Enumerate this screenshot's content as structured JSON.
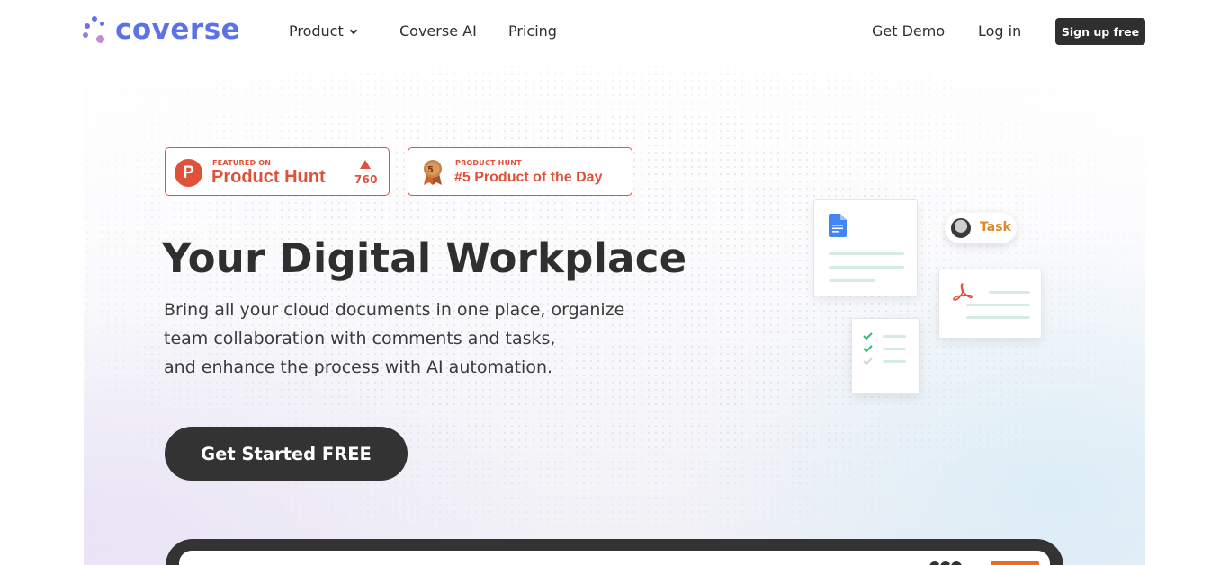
{
  "brand": {
    "name": "coverse",
    "colors": {
      "primary": "#5b72e8",
      "accent_orange": "#e0872d",
      "ph_red": "#e0513a",
      "dark": "#2f2f2f"
    }
  },
  "nav": {
    "links": [
      {
        "label": "Product",
        "has_dropdown": true
      },
      {
        "label": "Coverse AI"
      },
      {
        "label": "Pricing"
      }
    ],
    "get_demo": "Get Demo",
    "login": "Log in",
    "signup": "Sign up free"
  },
  "badges": {
    "featured": {
      "small": "FEATURED ON",
      "big": "Product Hunt",
      "icon_letter": "P",
      "votes": "760"
    },
    "award": {
      "small": "PRODUCT HUNT",
      "big": "#5 Product of the Day",
      "medal_number": "5"
    }
  },
  "hero": {
    "title": "Your Digital Workplace",
    "description_lines": [
      "Bring all your cloud documents in one place, organize",
      "team collaboration with comments and tasks,",
      "and enhance the process with AI automation."
    ],
    "cta": "Get Started FREE"
  },
  "illustration": {
    "task_label": "Task",
    "icons": [
      "google-docs-icon",
      "pdf-icon",
      "checklist-icon",
      "avatar"
    ]
  }
}
